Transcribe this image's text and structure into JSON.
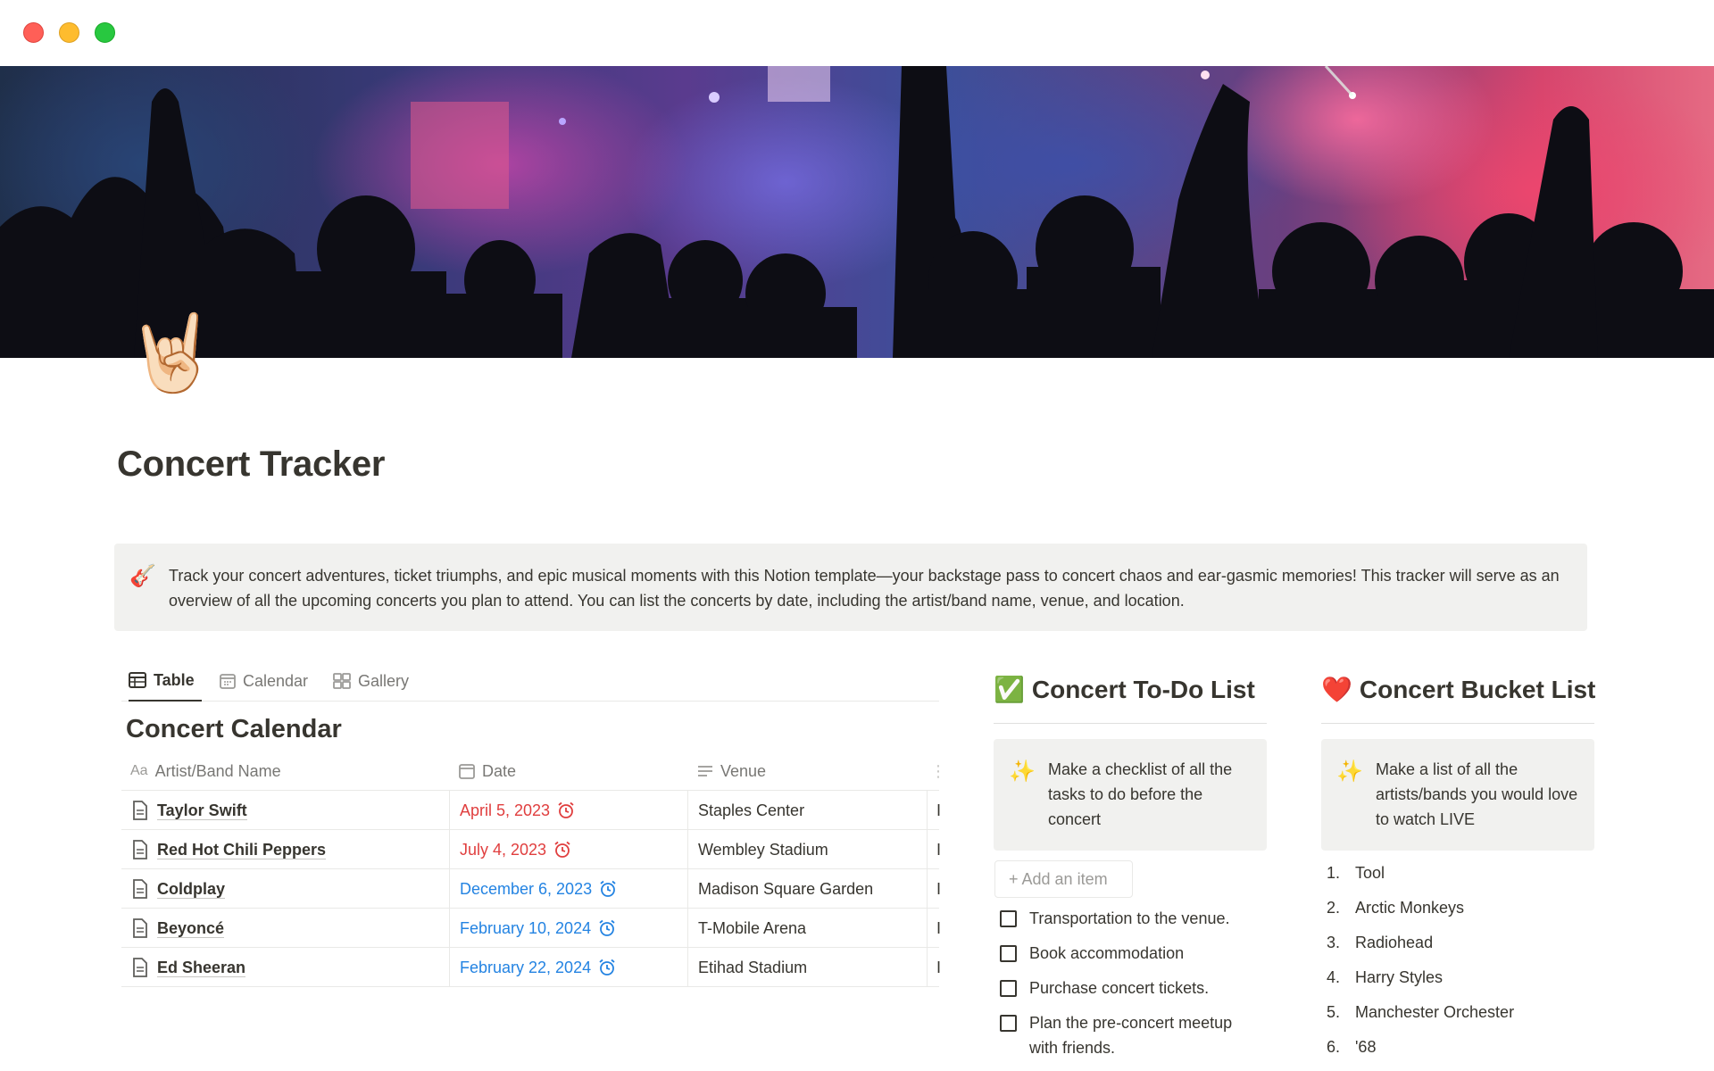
{
  "window": {
    "controls": [
      "close",
      "minimize",
      "zoom"
    ]
  },
  "page": {
    "icon": "🤘🏻",
    "title": "Concert Tracker"
  },
  "callout": {
    "icon": "🎸",
    "text": "Track your concert adventures, ticket triumphs, and epic musical moments with this Notion template—your backstage pass to concert chaos and ear-gasmic memories! This tracker will serve as an overview of all the upcoming concerts you plan to attend. You can list the concerts by date, including the artist/band name, venue, and location."
  },
  "database": {
    "views": [
      {
        "label": "Table",
        "icon": "table-icon",
        "active": true
      },
      {
        "label": "Calendar",
        "icon": "calendar-icon",
        "active": false
      },
      {
        "label": "Gallery",
        "icon": "gallery-icon",
        "active": false
      }
    ],
    "title": "Concert Calendar",
    "columns": {
      "name": {
        "icon": "Aa",
        "label": "Artist/Band Name"
      },
      "date": {
        "label": "Date"
      },
      "venue": {
        "label": "Venue"
      }
    },
    "rows": [
      {
        "name": "Taylor Swift",
        "date": "April 5, 2023",
        "date_color": "#e03e3e",
        "venue": "Staples Center",
        "more": "I"
      },
      {
        "name": "Red Hot Chili Peppers",
        "date": "July 4, 2023",
        "date_color": "#e03e3e",
        "venue": "Wembley Stadium",
        "more": "I"
      },
      {
        "name": "Coldplay",
        "date": "December 6, 2023",
        "date_color": "#2383e2",
        "venue": "Madison Square Garden",
        "more": "I"
      },
      {
        "name": "Beyoncé",
        "date": "February 10, 2024",
        "date_color": "#2383e2",
        "venue": "T-Mobile Arena",
        "more": "I"
      },
      {
        "name": "Ed Sheeran",
        "date": "February 22, 2024",
        "date_color": "#2383e2",
        "venue": "Etihad Stadium",
        "more": "I"
      }
    ]
  },
  "todo": {
    "emoji": "✅",
    "title": "Concert To-Do List",
    "tip_icon": "✨",
    "tip": "Make a checklist of all the tasks to do before the concert",
    "add_item": "+ Add an item",
    "items": [
      "Transportation to the venue.",
      "Book accommodation",
      "Purchase concert tickets.",
      "Plan the pre-concert meetup with friends."
    ]
  },
  "bucket": {
    "emoji": "❤️",
    "title": "Concert Bucket List",
    "tip_icon": "✨",
    "tip": "Make a list of all the artists/bands you would love to watch LIVE",
    "items": [
      {
        "num": "1.",
        "label": "Tool"
      },
      {
        "num": "2.",
        "label": "Arctic Monkeys"
      },
      {
        "num": "3.",
        "label": "Radiohead"
      },
      {
        "num": "4.",
        "label": "Harry Styles"
      },
      {
        "num": "5.",
        "label": "Manchester Orchester"
      },
      {
        "num": "6.",
        "label": "'68"
      }
    ]
  },
  "colors": {
    "date_past": "#e03e3e",
    "date_upcoming": "#2383e2",
    "callout_bg": "#f1f1ef",
    "text": "#37352f"
  }
}
